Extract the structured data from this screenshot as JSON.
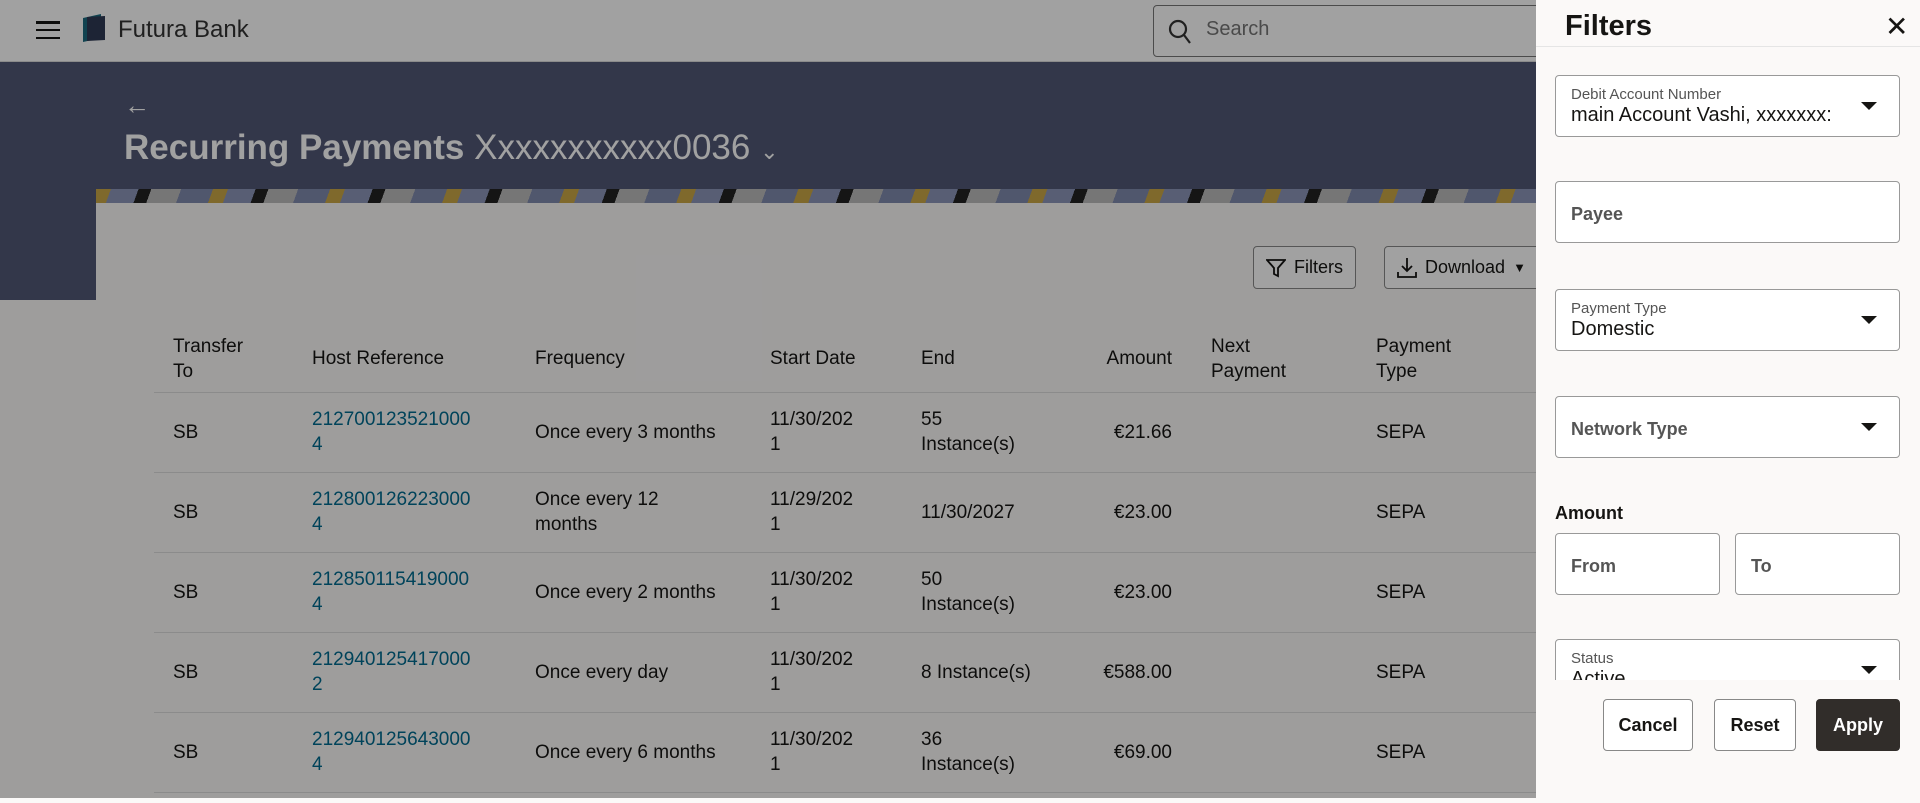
{
  "header": {
    "brand": "Futura Bank",
    "search_placeholder": "Search"
  },
  "page": {
    "title": "Recurring Payments",
    "account": "Xxxxxxxxxxx0036"
  },
  "toolbar": {
    "filters": "Filters",
    "download": "Download"
  },
  "table": {
    "columns": [
      [
        "Transfer",
        "To"
      ],
      [
        "Host Reference"
      ],
      [
        "Frequency"
      ],
      [
        "Start Date"
      ],
      [
        "End"
      ],
      [
        "Amount"
      ],
      [
        "Next",
        "Payment"
      ],
      [
        "Payment",
        "Type"
      ]
    ],
    "rows": [
      {
        "to": "SB",
        "ref1": "212700123521000",
        "ref2": "4",
        "freq1": "Once every 3 months",
        "freq2": "",
        "start1": "11/30/202",
        "start2": "1",
        "end1": "55",
        "end2": "Instance(s)",
        "amount": "€21.66",
        "next": "",
        "type": "SEPA"
      },
      {
        "to": "SB",
        "ref1": "212800126223000",
        "ref2": "4",
        "freq1": "Once every 12",
        "freq2": "months",
        "start1": "11/29/202",
        "start2": "1",
        "end1": "11/30/2027",
        "end2": "",
        "amount": "€23.00",
        "next": "",
        "type": "SEPA"
      },
      {
        "to": "SB",
        "ref1": "212850115419000",
        "ref2": "4",
        "freq1": "Once every 2 months",
        "freq2": "",
        "start1": "11/30/202",
        "start2": "1",
        "end1": "50",
        "end2": "Instance(s)",
        "amount": "€23.00",
        "next": "",
        "type": "SEPA"
      },
      {
        "to": "SB",
        "ref1": "212940125417000",
        "ref2": "2",
        "freq1": "Once every day",
        "freq2": "",
        "start1": "11/30/202",
        "start2": "1",
        "end1": "8 Instance(s)",
        "end2": "",
        "amount": "€588.00",
        "next": "",
        "type": "SEPA"
      },
      {
        "to": "SB",
        "ref1": "212940125643000",
        "ref2": "4",
        "freq1": "Once every 6 months",
        "freq2": "",
        "start1": "11/30/202",
        "start2": "1",
        "end1": "36",
        "end2": "Instance(s)",
        "amount": "€69.00",
        "next": "",
        "type": "SEPA"
      }
    ]
  },
  "filters": {
    "title": "Filters",
    "debit_label": "Debit Account Number",
    "debit_value": "main Account Vashi, xxxxxxx:",
    "payee_placeholder": "Payee",
    "payment_type_label": "Payment Type",
    "payment_type_value": "Domestic",
    "network_placeholder": "Network Type",
    "amount_label": "Amount",
    "from_placeholder": "From",
    "to_placeholder": "To",
    "status_label": "Status",
    "status_value": "Active",
    "cancel": "Cancel",
    "reset": "Reset",
    "apply": "Apply"
  }
}
